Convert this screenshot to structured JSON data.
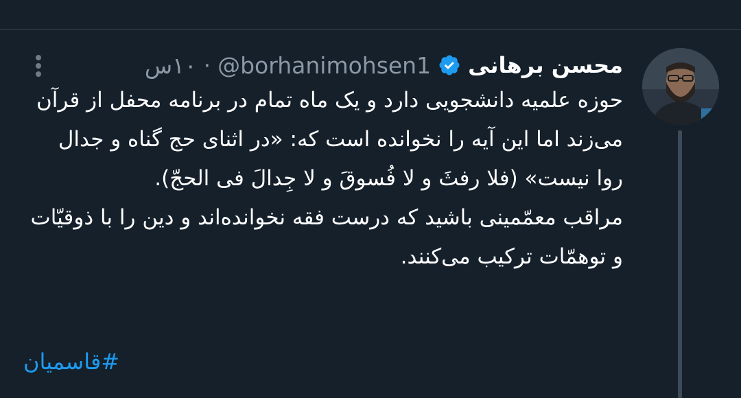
{
  "tweet": {
    "author": {
      "display_name": "محسن برهانی",
      "handle": "@borhanimohsen1",
      "verified": true,
      "avatar_icon": "user-photo-avatar"
    },
    "separator": "·",
    "time": "۱۰س",
    "paragraphs": [
      "حوزه علمیه دانشجویی دارد و یک ماه تمام در برنامه محفل از قرآن می‌زند اما این آیه را نخوانده است که: «در اثنای حج گناه و جدال روا نیست» (فلا رفثَ و لا فُسوقَ و لا جِدالَ فی الحجّ).",
      "مراقب معمّمینی باشید که درست فقه نخوانده‌اند و دین را با ذوقیّات و توهمّات ترکیب می‌کنند."
    ],
    "hashtag": "#قاسمیان"
  },
  "colors": {
    "background": "#15202b",
    "text": "#ffffff",
    "secondary_text": "#8b98a5",
    "link": "#1d9bf0",
    "verified_badge": "#1d9bf0",
    "divider": "#38444d"
  }
}
